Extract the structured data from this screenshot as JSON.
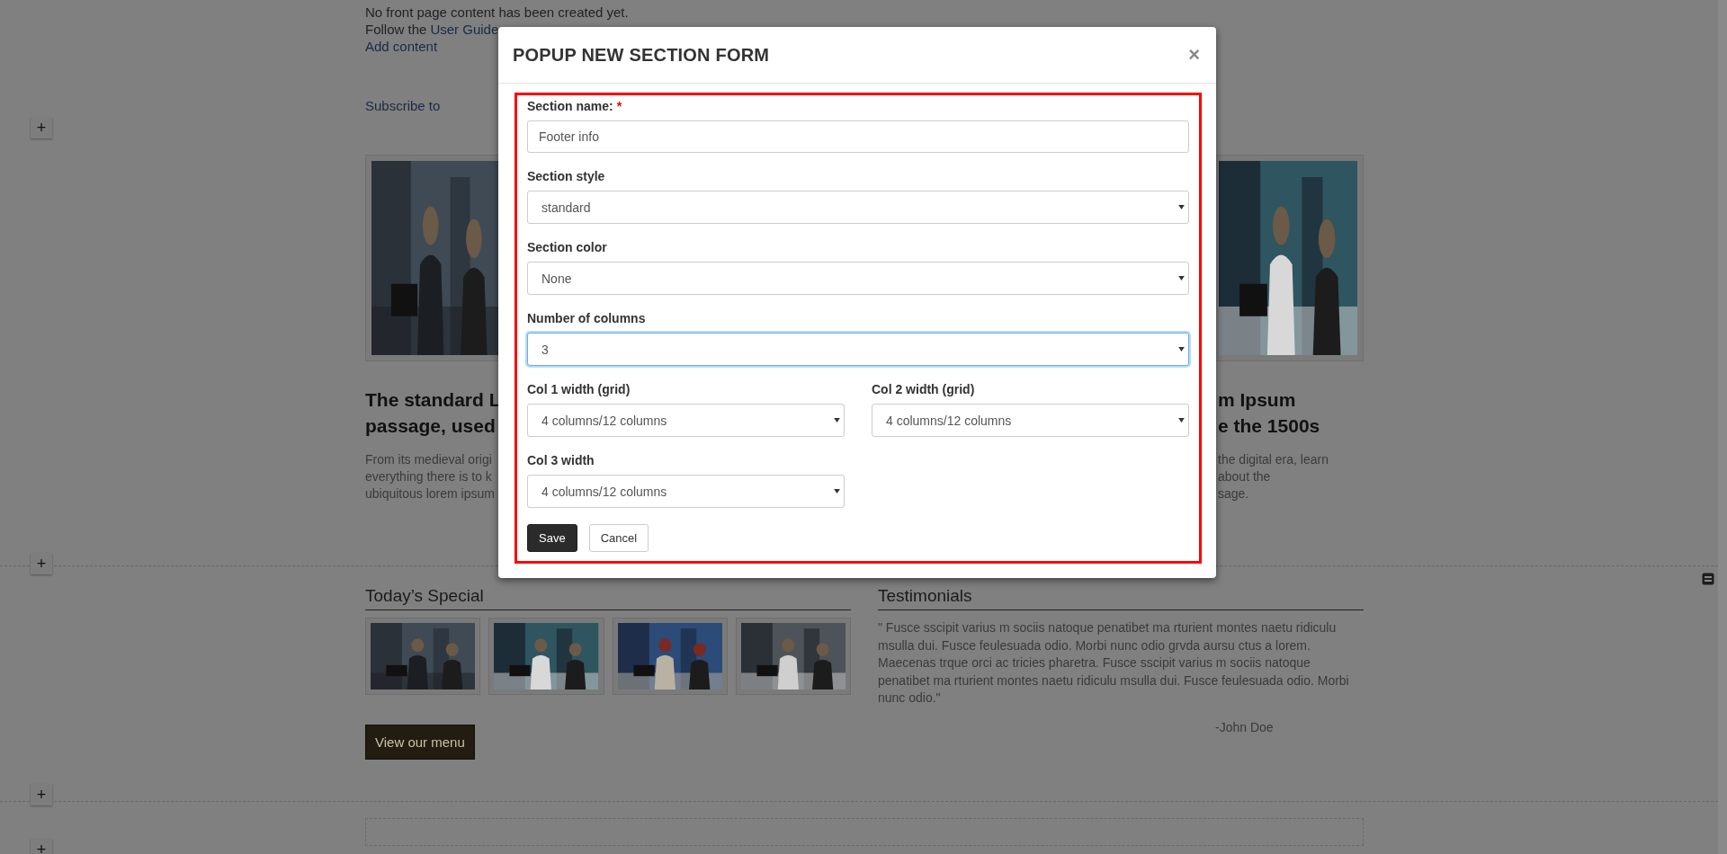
{
  "page": {
    "intro": {
      "line_1": "No front page content has been created yet.",
      "line_2": "Follow the",
      "link": "User Guide",
      "add_content": "Add content"
    },
    "subscribe": "Subscribe to",
    "features": [
      {
        "image": {
          "kind": "picture"
        },
        "heading_lines": [
          "The standard L",
          "passage, used"
        ],
        "body_lines": [
          "From its medieval origi",
          "everything there is to k",
          "ubiquitous lorem ipsum"
        ]
      },
      {
        "image": {
          "kind": "picture"
        },
        "heading_lines": [
          "m Ipsum",
          "e the 1500s"
        ],
        "body_lines": [
          "the digital era, learn",
          "about the",
          "sage."
        ]
      }
    ],
    "todays_special": {
      "title": "Today’s Special",
      "thumbnails": [
        {
          "kind": "picture"
        },
        {
          "kind": "picture"
        },
        {
          "kind": "picture"
        },
        {
          "kind": "picture"
        }
      ],
      "button": "View our menu"
    },
    "testimonials": {
      "title": "Testimonials",
      "quote": "\" Fusce sscipit varius m sociis natoque penatibet ma rturient montes naetu ridiculu msulla dui. Fusce feulesuada odio. Morbi nunc odio grvda aursu ctus a lorem. Maecenas trque orci ac tricies pharetra. Fusce sscipit varius m sociis natoque penatibet ma rturient montes naetu ridiculu msulla dui. Fusce feulesuada odio. Morbi nunc odio.\"",
      "author": "-John Doe"
    },
    "add_section_buttons": [
      "+",
      "+",
      "+",
      "+"
    ]
  },
  "modal": {
    "title": "POPUP NEW SECTION FORM",
    "close": "×",
    "fields": [
      {
        "label": "Section name:",
        "required_mark": "*",
        "kind": "text",
        "value": "Footer info",
        "focused": false
      },
      {
        "label": "Section style",
        "kind": "select",
        "value": "standard",
        "focused": false
      },
      {
        "label": "Section color",
        "kind": "select",
        "value": "None",
        "focused": false
      },
      {
        "label": "Number of columns",
        "kind": "select",
        "value": "3",
        "focused": true
      },
      {
        "label": "Col 1 width (grid)",
        "kind": "select",
        "value": "4 columns/12 columns",
        "focused": false
      },
      {
        "label": "Col 2 width (grid)",
        "kind": "select",
        "value": "4 columns/12 columns",
        "focused": false
      },
      {
        "label": "Col 3 width",
        "kind": "select",
        "value": "4 columns/12 columns",
        "focused": false
      }
    ],
    "buttons": [
      {
        "label": "Save",
        "kind": "primary"
      },
      {
        "label": "Cancel",
        "kind": "default"
      }
    ]
  }
}
